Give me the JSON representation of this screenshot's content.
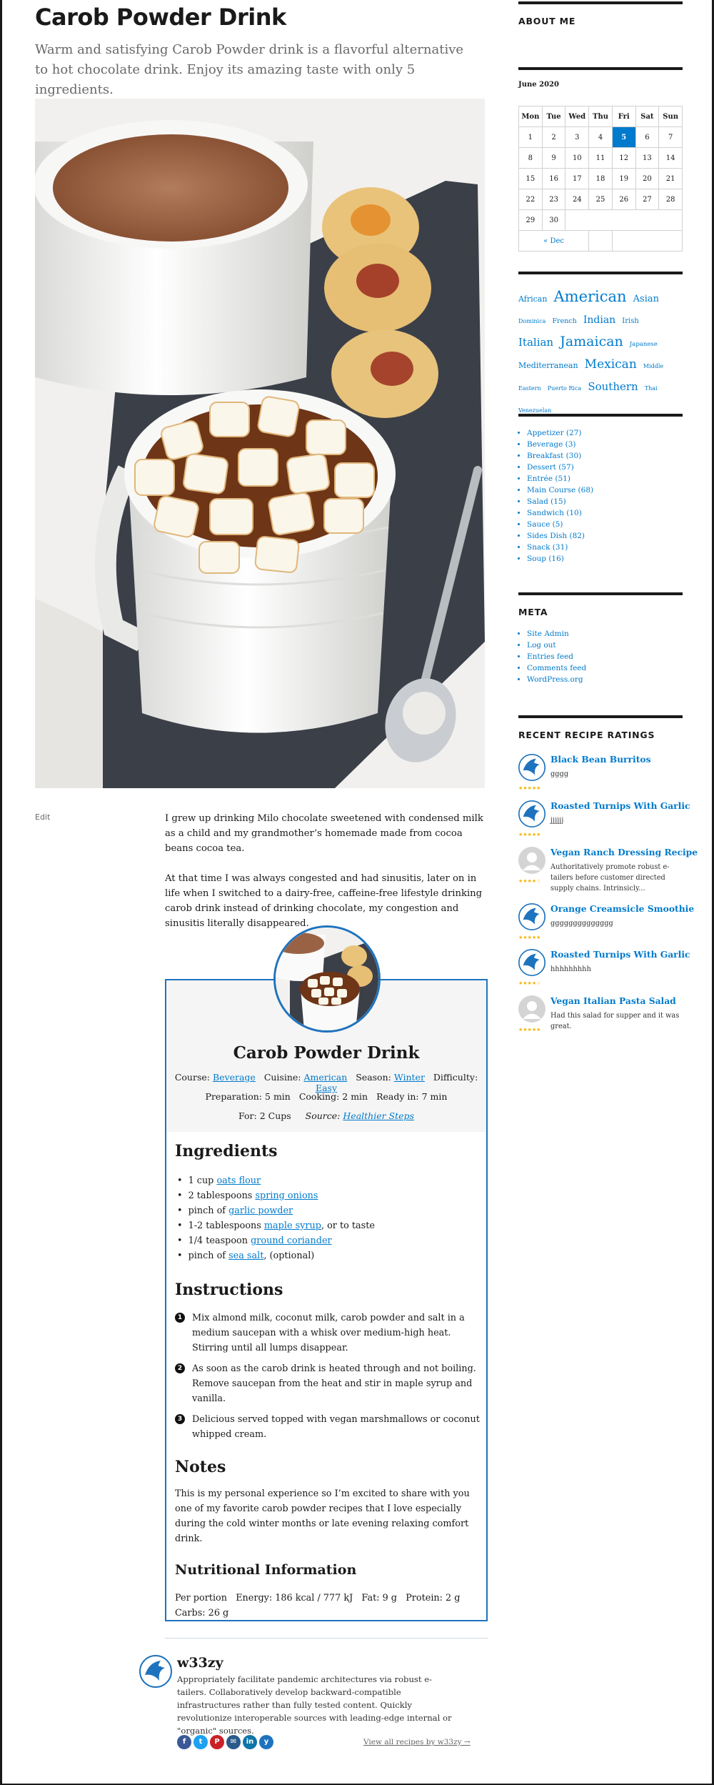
{
  "post": {
    "title": "Carob Powder Drink",
    "excerpt": "Warm and satisfying Carob Powder drink is a flavorful alternative to hot chocolate drink. Enjoy its amazing taste with only 5 ingredients.",
    "edit_label": "Edit",
    "paragraphs": [
      "I grew up drinking Milo chocolate sweetened with condensed milk as a child and my grandmother’s homemade made from cocoa beans cocoa tea.",
      "At that time I was always congested and had sinusitis, later on in life when I switched to a dairy-free, caffeine-free lifestyle drinking carob drink instead of drinking chocolate, my congestion and sinusitis literally disappeared."
    ]
  },
  "recipe": {
    "title": "Carob Powder Drink",
    "course_label": "Course:",
    "course": "Beverage",
    "cuisine_label": "Cuisine:",
    "cuisine": "American",
    "season_label": "Season:",
    "season": "Winter",
    "difficulty_label": "Difficulty:",
    "difficulty": "Easy",
    "prep_label": "Preparation:",
    "prep": "5 min",
    "cook_label": "Cooking:",
    "cook": "2 min",
    "ready_label": "Ready in:",
    "ready": "7 min",
    "for_label": "For:",
    "servings": "2 Cups",
    "source_label": "Source:",
    "source": "Healthier Steps",
    "ingredients_heading": "Ingredients",
    "ingredients": [
      {
        "pre": "1 cup ",
        "link": "oats flour",
        "post": ""
      },
      {
        "pre": "2 tablespoons ",
        "link": "spring onions",
        "post": ""
      },
      {
        "pre": "pinch of ",
        "link": "garlic powder",
        "post": ""
      },
      {
        "pre": "1-2 tablespoons ",
        "link": "maple syrup",
        "post": ", or to taste"
      },
      {
        "pre": "1/4 teaspoon ",
        "link": "ground coriander",
        "post": ""
      },
      {
        "pre": "pinch of ",
        "link": "sea salt",
        "post": ", (optional)"
      }
    ],
    "instructions_heading": "Instructions",
    "steps": [
      {
        "num": "1",
        "text": "Mix almond milk, coconut milk, carob powder and salt in a medium saucepan with a whisk over medium-high heat. Stirring until all lumps disappear."
      },
      {
        "num": "2",
        "text": "As soon as the carob drink is heated through and not boiling. Remove saucepan from the heat and stir in maple syrup and vanilla."
      },
      {
        "num": "3",
        "text": "Delicious served topped with vegan marshmallows or coconut whipped cream."
      }
    ],
    "notes_heading": "Notes",
    "notes": "This is my personal experience so I’m excited to share with you one of my favorite carob powder recipes that I love especially during the cold winter months or late evening relaxing comfort drink.",
    "nutrition_heading": "Nutritional Information",
    "nutrition_line1": "Per portion   Energy: 186 kcal / 777 kJ   Fat: 9 g   Protein: 2 g",
    "nutrition_line2": "Carbs: 26 g"
  },
  "author": {
    "name": "w33zy",
    "bio": "Appropriately facilitate pandemic architectures via robust e-tailers. Collaboratively develop backward-compatible infrastructures rather than fully tested content. Quickly revolutionize interoperable sources with leading-edge internal or \"organic\" sources.",
    "view_all": "View all recipes by w33zy →",
    "social": [
      {
        "icon": "facebook-icon",
        "glyph": "f",
        "color": "#3b5998"
      },
      {
        "icon": "twitter-icon",
        "glyph": "t",
        "color": "#1da1f2"
      },
      {
        "icon": "pinterest-icon",
        "glyph": "P",
        "color": "#cb2027"
      },
      {
        "icon": "email-icon",
        "glyph": "✉",
        "color": "#2a5a8a"
      },
      {
        "icon": "linkedin-icon",
        "glyph": "in",
        "color": "#0e76a8"
      },
      {
        "icon": "yummly-icon",
        "glyph": "y",
        "color": "#1e73be"
      }
    ]
  },
  "sidebar": {
    "about_title": "ABOUT ME",
    "calendar": {
      "caption": "June 2020",
      "days": [
        "Mon",
        "Tue",
        "Wed",
        "Thu",
        "Fri",
        "Sat",
        "Sun"
      ],
      "weeks": [
        [
          "1",
          "2",
          "3",
          "4",
          "5",
          "6",
          "7"
        ],
        [
          "8",
          "9",
          "10",
          "11",
          "12",
          "13",
          "14"
        ],
        [
          "15",
          "16",
          "17",
          "18",
          "19",
          "20",
          "21"
        ],
        [
          "22",
          "23",
          "24",
          "25",
          "26",
          "27",
          "28"
        ],
        [
          "29",
          "30",
          "",
          "",
          "",
          "",
          ""
        ]
      ],
      "today": "5",
      "prev": "« Dec"
    },
    "tags": [
      {
        "label": "African",
        "size": 11
      },
      {
        "label": "American",
        "size": 21
      },
      {
        "label": "Asian",
        "size": 13
      },
      {
        "label": "Dominica",
        "size": 8
      },
      {
        "label": "French",
        "size": 9.5
      },
      {
        "label": "Indian",
        "size": 14
      },
      {
        "label": "Irish",
        "size": 10
      },
      {
        "label": "Italian",
        "size": 15
      },
      {
        "label": "Jamaican",
        "size": 19
      },
      {
        "label": "Japanese",
        "size": 8.5
      },
      {
        "label": "Mediterranean",
        "size": 11
      },
      {
        "label": "Mexican",
        "size": 17
      },
      {
        "label": "Middle Eastern",
        "size": 8
      },
      {
        "label": "Puerto Rica",
        "size": 8
      },
      {
        "label": "Southern",
        "size": 15
      },
      {
        "label": "Thai",
        "size": 8
      },
      {
        "label": "Venezuelan",
        "size": 8
      }
    ],
    "categories": [
      "Appetizer (27)",
      "Beverage (3)",
      "Breakfast (30)",
      "Dessert (57)",
      "Entrée (51)",
      "Main Course (68)",
      "Salad (15)",
      "Sandwich (10)",
      "Sauce (5)",
      "Sides Dish (82)",
      "Snack (31)",
      "Soup (16)"
    ],
    "meta_title": "META",
    "meta_links": [
      "Site Admin",
      "Log out",
      "Entries feed",
      "Comments feed",
      "WordPress.org"
    ],
    "ratings_title": "RECENT RECIPE RATINGS",
    "ratings": [
      {
        "title": "Black Bean Burritos",
        "text": "gggg",
        "avatar": "bird",
        "stars": 5
      },
      {
        "title": "Roasted Turnips With Garlic",
        "text": "jjjjjj",
        "avatar": "bird",
        "stars": 5
      },
      {
        "title": "Vegan Ranch Dressing Recipe",
        "text": "Authoritatively promote robust e-tailers before customer directed supply chains. Intrinsicly...",
        "avatar": "person",
        "stars": 4
      },
      {
        "title": "Orange Creamsicle Smoothie",
        "text": "gggggggggggggg",
        "avatar": "bird",
        "stars": 5
      },
      {
        "title": "Roasted Turnips With Garlic",
        "text": "hhhhhhhhh",
        "avatar": "bird",
        "stars": 4
      },
      {
        "title": "Vegan Italian Pasta Salad",
        "text": "Had this salad for supper and it was great.",
        "avatar": "person",
        "stars": 5
      }
    ]
  }
}
